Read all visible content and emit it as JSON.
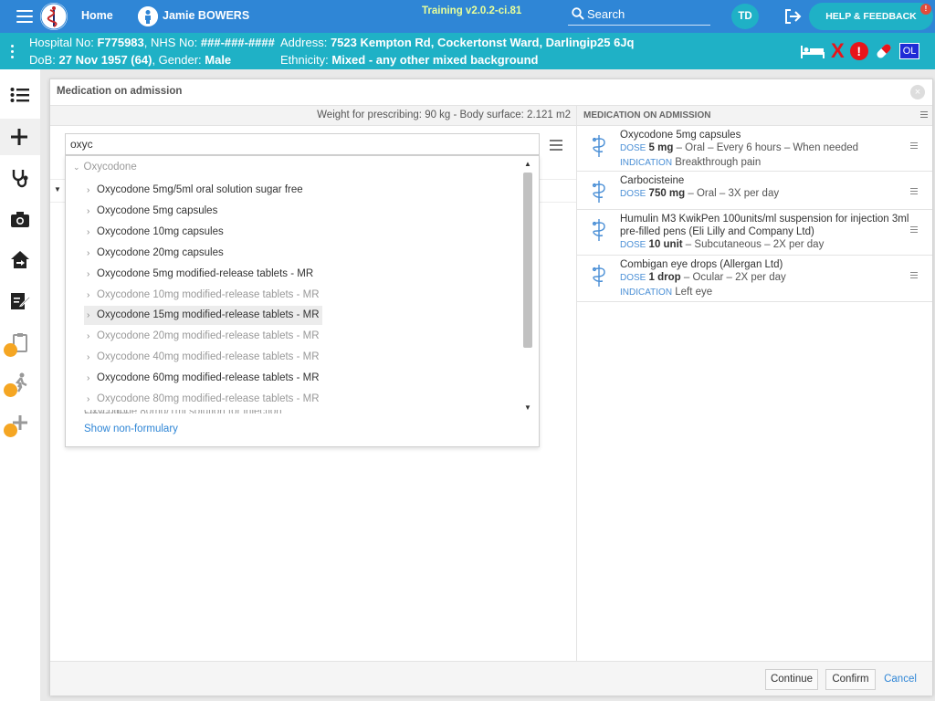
{
  "topbar": {
    "home_label": "Home",
    "patient_name": "Jamie BOWERS",
    "version": "Training v2.0.2-ci.81",
    "search_label": "Search",
    "user_initials": "TD",
    "help_label": "HELP & FEEDBACK",
    "help_badge": "!"
  },
  "banner": {
    "hospital_label": "Hospital No:",
    "hospital_no": "F775983",
    "nhs_label": ", NHS No:",
    "nhs_no": "###-###-####",
    "address_label": "Address:",
    "address": "7523 Kempton Rd, Cockertonst Ward, Darlingip25 6Jq",
    "dob_label": "DoB:",
    "dob": "27 Nov 1957 (64)",
    "gender_label": ", Gender:",
    "gender": "Male",
    "ethnicity_label": "Ethnicity:",
    "ethnicity": "Mixed - any other mixed background",
    "flag_x": "X",
    "flag_alert": "!",
    "flag_ol": "OL"
  },
  "modal": {
    "title": "Medication on admission",
    "close": "×",
    "weight_text": "Weight for prescribing: 90 kg - Body surface: 2.121 m2",
    "search_value": "oxyc",
    "group_label": "Oxycodone",
    "results": [
      {
        "label": "Oxycodone 5mg/5ml oral solution sugar free",
        "state": "active"
      },
      {
        "label": "Oxycodone 5mg capsules",
        "state": "active"
      },
      {
        "label": "Oxycodone 10mg capsules",
        "state": "active"
      },
      {
        "label": "Oxycodone 20mg capsules",
        "state": "active"
      },
      {
        "label": "Oxycodone 5mg modified-release tablets - MR",
        "state": "active"
      },
      {
        "label": "Oxycodone 10mg modified-release tablets - MR",
        "state": "dim"
      },
      {
        "label": "Oxycodone 15mg modified-release tablets - MR",
        "state": "hl"
      },
      {
        "label": "Oxycodone 20mg modified-release tablets - MR",
        "state": "dim"
      },
      {
        "label": "Oxycodone 40mg modified-release tablets - MR",
        "state": "dim"
      },
      {
        "label": "Oxycodone 60mg modified-release tablets - MR",
        "state": "active"
      },
      {
        "label": "Oxycodone 80mg modified-release tablets - MR",
        "state": "dim"
      }
    ],
    "show_non_formulary": "Show non-formulary",
    "right_title": "MEDICATION ON ADMISSION",
    "medications": [
      {
        "name": "Oxycodone 5mg capsules",
        "dose_tag": "DOSE",
        "dose_value": "5 mg",
        "dose_detail": " – Oral – Every 6 hours – When needed",
        "indication_tag": "INDICATION",
        "indication": "Breakthrough pain"
      },
      {
        "name": "Carbocisteine",
        "dose_tag": "DOSE",
        "dose_value": "750 mg",
        "dose_detail": " – Oral – 3X per day"
      },
      {
        "name": "Humulin M3 KwikPen 100units/ml suspension for injection 3ml pre-filled pens (Eli Lilly and Company Ltd)",
        "dose_tag": "DOSE",
        "dose_value": "10 unit",
        "dose_detail": " – Subcutaneous – 2X per day"
      },
      {
        "name": "Combigan eye drops (Allergan Ltd)",
        "dose_tag": "DOSE",
        "dose_value": "1 drop",
        "dose_detail": " – Ocular – 2X per day",
        "indication_tag": "INDICATION",
        "indication": "Left eye"
      }
    ],
    "buttons": {
      "continue": "Continue",
      "confirm": "Confirm",
      "cancel": "Cancel"
    }
  },
  "colors": {
    "topbar": "#2f86d6",
    "banner": "#1fb1c6",
    "lock": "#f5a623",
    "alert": "#e8141a"
  }
}
